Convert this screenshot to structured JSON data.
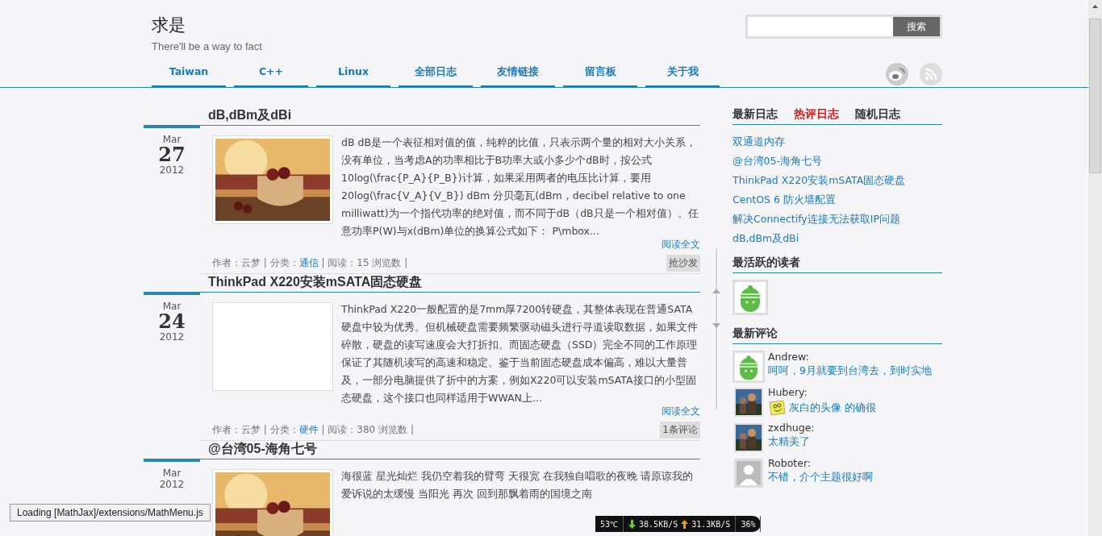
{
  "site": {
    "title": "求是",
    "tagline": "There'll be a way to fact"
  },
  "search": {
    "button": "搜索"
  },
  "nav": [
    {
      "label": "Taiwan"
    },
    {
      "label": "C++"
    },
    {
      "label": "Linux"
    },
    {
      "label": "全部日志"
    },
    {
      "label": "友情链接"
    },
    {
      "label": "留言板"
    },
    {
      "label": "关于我"
    }
  ],
  "posts": [
    {
      "title": "dB,dBm及dBi",
      "month": "Mar",
      "day": "27",
      "year": "2012",
      "thumbnail": {
        "kind": "picture"
      },
      "excerpt": "dB dB是一个表征相对值的值，纯粹的比值，只表示两个量的相对大小关系，没有单位，当考虑A的功率相比于B功率大或小多少个dB时，按公式10log(\\frac{P_A}{P_B})计算，如果采用两者的电压比计算，要用20log(\\frac{V_A}{V_B}) dBm 分贝毫瓦(dBm，decibel relative to one milliwatt)为一个指代功率的绝对值，而不同于dB（dB只是一个相对值）。任意功率P(W)与x(dBm)单位的换算公式如下： P\\mbox...",
      "more": "阅读全文",
      "meta_before": "作者：云梦 | 分类：",
      "category": "通信",
      "meta_after": " | 阅读：15 浏览数 |",
      "comments": "抢沙发"
    },
    {
      "title": "ThinkPad X220安装mSATA固态硬盘",
      "month": "Mar",
      "day": "24",
      "year": "2012",
      "thumbnail": {
        "kind": "empty"
      },
      "excerpt": "ThinkPad X220一般配置的是7mm厚7200转硬盘，其整体表现在普通SATA硬盘中较为优秀。但机械硬盘需要频繁驱动磁头进行寻道读取数据，如果文件碎散，硬盘的读写速度会大打折扣。而固态硬盘（SSD）完全不同的工作原理保证了其随机读写的高速和稳定。鉴于当前固态硬盘成本偏高，难以大量普及，一部分电脑提供了折中的方案，例如X220可以安装mSATA接口的小型固态硬盘，这个接口也同样适用于WWAN上...",
      "more": "阅读全文",
      "meta_before": "作者：云梦 | 分类：",
      "category": "硬件",
      "meta_after": " | 阅读：380 浏览数 |",
      "comments": "1条评论"
    },
    {
      "title": "@台湾05-海角七号",
      "month": "Mar",
      "year": "2012",
      "thumbnail": {
        "kind": "picture"
      },
      "excerpt_lines": [
        "海很蓝 星光灿烂 我仍空着我的臂弯 天很宽 在我独自唱歌的夜晚 请原谅我的",
        "爱诉说的太缓慢 当阳光 再次 回到那飘着雨的国境之南"
      ]
    }
  ],
  "sidebar": {
    "tabs": [
      {
        "label": "最新日志",
        "selected": false
      },
      {
        "label": "热评日志",
        "selected": true
      },
      {
        "label": "随机日志",
        "selected": false
      }
    ],
    "posts": [
      "双通道内存",
      "@台湾05-海角七号",
      "ThinkPad X220安装mSATA固态硬盘",
      "CentOS 6 防火墙配置",
      "解决Connectify连接无法获取IP问题",
      "dB,dBm及dBi"
    ],
    "readers_title": "最活跃的读者",
    "readers": [
      {
        "avatar": {
          "kind": "robot"
        }
      }
    ],
    "comments_title": "最新评论",
    "comments": [
      {
        "name": "Andrew:",
        "text": "呵呵，9月就要到台湾去，到时实地",
        "avatar": {
          "kind": "robot"
        },
        "emoticon": false
      },
      {
        "name": "Hubery:",
        "text": "灰白的头像 的确很",
        "avatar": {
          "kind": "picture"
        },
        "emoticon": true
      },
      {
        "name": "zxdhuge:",
        "text": "太精美了",
        "avatar": {
          "kind": "picture"
        },
        "emoticon": false
      },
      {
        "name": "Roboter:",
        "text": "不错，介个主题很好啊",
        "avatar": {
          "kind": "default"
        },
        "emoticon": false
      }
    ]
  },
  "status_tooltip": "Loading [MathJax]/extensions/MathMenu.js",
  "monitor": {
    "temperature": "53℃",
    "download": "38.5KB/S",
    "upload": "31.3KB/S",
    "percent": "36%"
  }
}
